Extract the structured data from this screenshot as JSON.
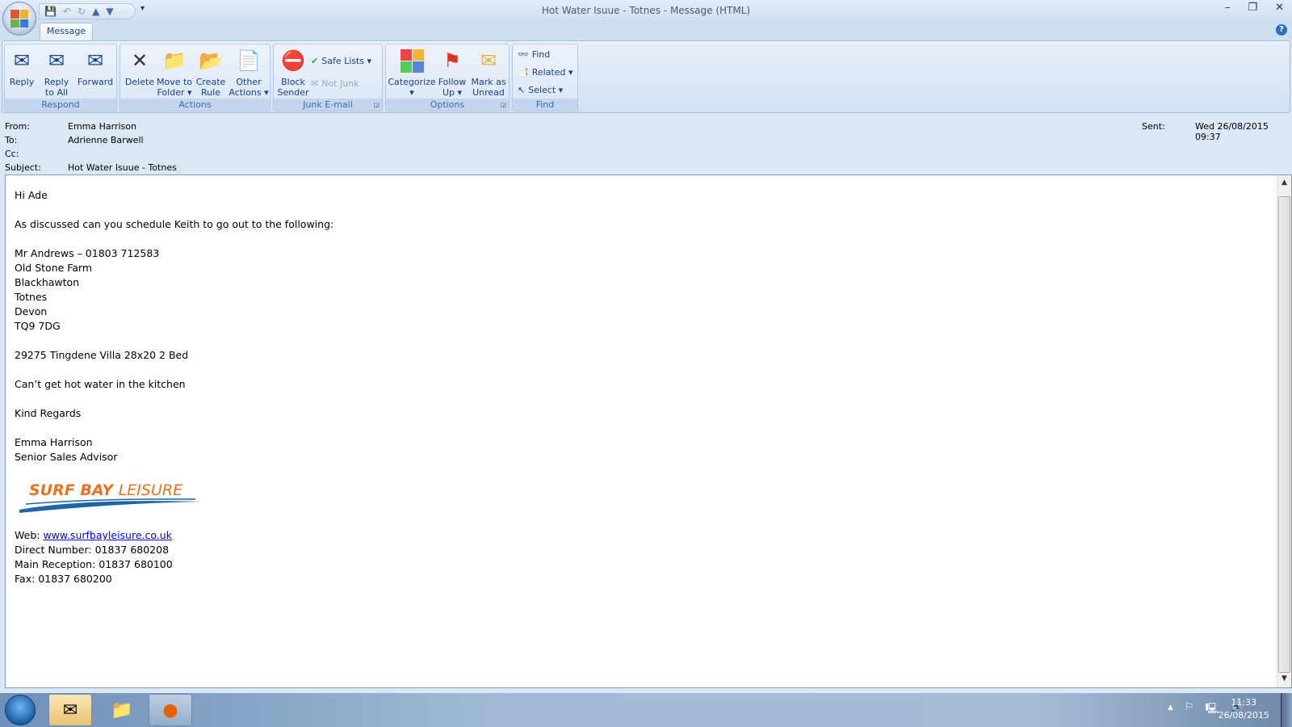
{
  "window": {
    "title": "Hot Water Isuue - Totnes - Message (HTML)",
    "min": "–",
    "restore": "❐",
    "close": "✕"
  },
  "tabs": [
    {
      "label": "Message"
    }
  ],
  "ribbon": {
    "respond": {
      "label": "Respond",
      "reply": "Reply",
      "reply_all": [
        "Reply",
        "to All"
      ],
      "forward": "Forward"
    },
    "actions": {
      "label": "Actions",
      "delete": "Delete",
      "move": [
        "Move to",
        "Folder ▾"
      ],
      "rule": [
        "Create",
        "Rule"
      ],
      "other": [
        "Other",
        "Actions ▾"
      ]
    },
    "junk": {
      "label": "Junk E-mail",
      "block": [
        "Block",
        "Sender"
      ],
      "safe_lists": "Safe Lists ▾",
      "not_junk": "Not Junk"
    },
    "options": {
      "label": "Options",
      "categorize": [
        "Categorize",
        "▾"
      ],
      "follow_up": [
        "Follow",
        "Up ▾"
      ],
      "mark_unread": [
        "Mark as",
        "Unread"
      ]
    },
    "find": {
      "label": "Find",
      "find": "Find",
      "related": "Related ▾",
      "select": "Select ▾"
    }
  },
  "header": {
    "from_label": "From:",
    "from": "Emma Harrison",
    "to_label": "To:",
    "to": "Adrienne Barwell",
    "cc_label": "Cc:",
    "cc": "",
    "subject_label": "Subject:",
    "subject": "Hot Water Isuue - Totnes",
    "sent_label": "Sent:",
    "sent": "Wed 26/08/2015 09:37"
  },
  "body": {
    "greeting": "Hi Ade",
    "intro": "As discussed can you schedule Keith to go out to the following:",
    "address": [
      "Mr Andrews – 01803 712583",
      "Old Stone Farm",
      "Blackhawton",
      "Totnes",
      "Devon",
      "TQ9 7DG"
    ],
    "unit": "29275 Tingdene Villa 28x20 2 Bed",
    "issue": "Can’t get hot water in the kitchen",
    "signoff": "Kind Regards",
    "name": "Emma Harrison",
    "role": "Senior Sales Advisor",
    "logo_text": "SURF BAY LEISURE",
    "web_label": "Web: ",
    "web": "www.surfbayleisure.co.uk",
    "direct": "Direct Number:  01837 680208",
    "reception": "Main Reception:  01837 680100",
    "fax": "Fax:  01837 680200"
  },
  "taskbar": {
    "time": "11:33",
    "date": "26/08/2015"
  },
  "colors": {
    "logo_orange": "#e8731e",
    "logo_blue": "#1f63a8",
    "link": "#0000ee"
  }
}
